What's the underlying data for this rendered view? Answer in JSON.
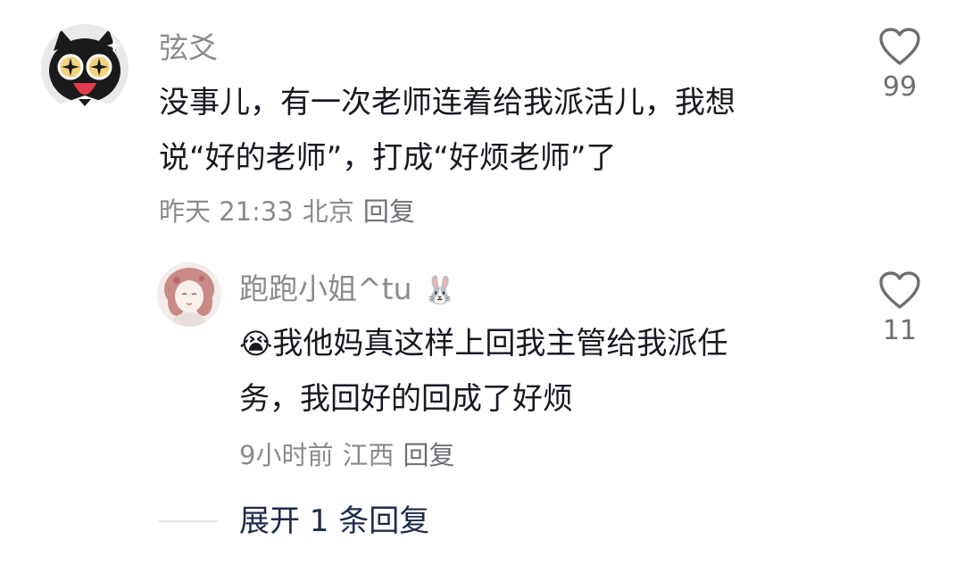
{
  "comment": {
    "username": "弦爻",
    "text_line1": "没事儿，有一次老师连着给我派活儿，我想",
    "text_line2": "说“好的老师”，打成“好烦老师”了",
    "time": "昨天 21:33",
    "location": "北京",
    "reply_label": "回复",
    "like_count": "99",
    "avatar_icon": "cartoon-cat-avatar-icon"
  },
  "reply": {
    "username": "跑跑小姐^tu",
    "username_emoji": "🐰",
    "text_emoji": "😭",
    "text_line1": "我他妈真这样上回我主管给我派任",
    "text_line2": "务，我回好的回成了好烦",
    "time": "9小时前",
    "location": "江西",
    "reply_label": "回复",
    "like_count": "11",
    "avatar_icon": "illustrated-girl-avatar-icon"
  },
  "expand": {
    "label": "展开 1 条回复"
  },
  "colors": {
    "meta_gray": "#8a8b91",
    "text_dark": "#161823",
    "expand_blue": "#1f2b4d",
    "heart_outline": "#6e6f76"
  }
}
